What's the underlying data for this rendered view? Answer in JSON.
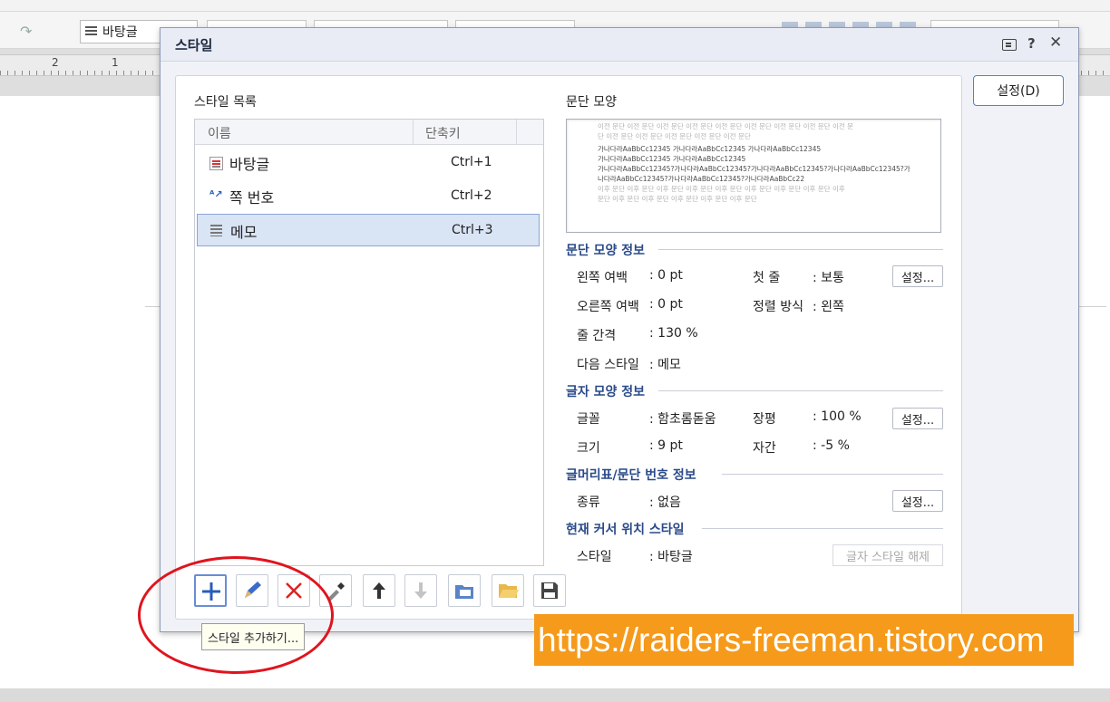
{
  "toolbar": {
    "style_select": "바탕글"
  },
  "ruler": {
    "numbers": [
      "2",
      "1"
    ]
  },
  "dialog": {
    "title": "스타일",
    "settings_button": "설정(D)",
    "style_list": {
      "label": "스타일 목록",
      "col_name": "이름",
      "col_shortcut": "단축키",
      "rows": [
        {
          "name": "바탕글",
          "shortcut": "Ctrl+1"
        },
        {
          "name": "쪽 번호",
          "shortcut": "Ctrl+2"
        },
        {
          "name": "메모",
          "shortcut": "Ctrl+3"
        }
      ],
      "selected_index": 2
    },
    "preview": {
      "label": "문단 모양",
      "lines": [
        "이전 문단 이전 문단 이전 문단 이전 문단 이전 문단 이전 문단 이전 문단 이전 문단 이전 문",
        "단 이전 문단 이전 문단 이전 문단 이전 문단 이전 문단",
        "가나다라AaBbCc12345 가나다라AaBbCc12345 가나다라AaBbCc12345",
        "가나다라AaBbCc12345 가나다라AaBbCc12345",
        "가나다라AaBbCc12345?가나다라AaBbCc12345?가나다라AaBbCc12345?가나다라AaBbCc12345?가",
        "나다라AaBbCc12345?가나다라AaBbCc12345?가나다라AaBbCc22",
        "이후 문단 이후 문단 이후 문단 이후 문단 이후 문단 이후 문단 이후 문단 이후 문단 이후",
        "문단 이후 문단 이후 문단 이후 문단 이후 문단 이후 문단"
      ]
    },
    "para_info": {
      "title": "문단 모양 정보",
      "left_margin_label": "왼쪽 여백",
      "left_margin": ": 0 pt",
      "right_margin_label": "오른쪽 여백",
      "right_margin": ": 0 pt",
      "line_spacing_label": "줄 간격",
      "line_spacing": ": 130 %",
      "next_style_label": "다음 스타일",
      "next_style": ": 메모",
      "first_line_label": "첫 줄",
      "first_line": ": 보통",
      "align_label": "정렬 방식",
      "align": ": 왼쪽",
      "settings_button": "설정..."
    },
    "char_info": {
      "title": "글자 모양 정보",
      "font_label": "글꼴",
      "font": ": 함초롬돋움",
      "size_label": "크기",
      "size": ": 9 pt",
      "width_label": "장평",
      "width": ": 100 %",
      "spacing_label": "자간",
      "spacing": ": -5 %",
      "settings_button": "설정..."
    },
    "bullet_info": {
      "title": "글머리표/문단 번호 정보",
      "type_label": "종류",
      "type": ": 없음",
      "settings_button": "설정..."
    },
    "cursor_info": {
      "title": "현재 커서 위치 스타일",
      "style_label": "스타일",
      "style": ": 바탕글",
      "release_button": "글자 스타일 해제"
    },
    "tooltip": "스타일 추가하기..."
  },
  "watermark": "https://raiders-freeman.tistory.com",
  "colors": {
    "accent": "#5b7fc7",
    "annotation": "#e0141e",
    "watermark_bg": "#f59a1b"
  }
}
